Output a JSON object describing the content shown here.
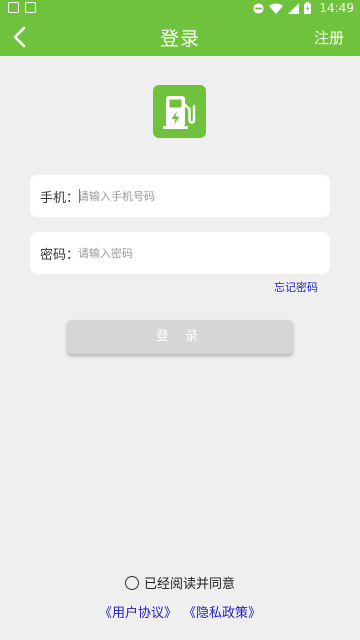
{
  "status_bar": {
    "time": "14:49"
  },
  "app_bar": {
    "title": "登录",
    "register_label": "注册"
  },
  "form": {
    "phone": {
      "label": "手机：",
      "placeholder": "请输入手机号码",
      "value": ""
    },
    "password": {
      "label": "密码：",
      "placeholder": "请输入密码",
      "value": ""
    },
    "forgot_label": "忘记密码",
    "login_label": "登 录"
  },
  "agreement": {
    "text": "已经阅读并同意",
    "user_agreement": "《用户协议》",
    "privacy_policy": "《隐私政策》"
  },
  "colors": {
    "brand": "#6fc23b",
    "link": "#2222bb",
    "button_disabled": "#d6d6d6"
  }
}
